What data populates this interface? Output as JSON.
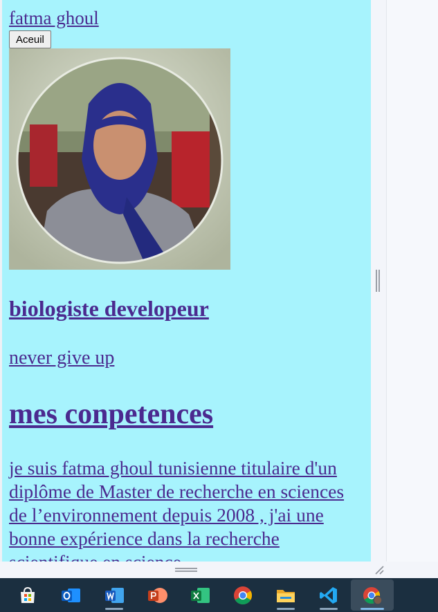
{
  "site": {
    "title": "fatma ghoul",
    "home_button": "Aceuil"
  },
  "profile": {
    "role_heading": "biologiste developeur",
    "motto": "never give up"
  },
  "skills": {
    "heading": "mes conpetences",
    "bio": "je suis fatma ghoul tunisienne titulaire d'un diplôme de Master de recherche en sciences de l’environnement depuis 2008 , j'ai une bonne expérience dans la recherche scientifique en science"
  },
  "colors": {
    "page_background": "#a7f3fd",
    "link": "#4b2a8f"
  },
  "taskbar": {
    "apps": [
      {
        "icon": "microsoft-store-icon",
        "running": false
      },
      {
        "icon": "outlook-icon",
        "running": false
      },
      {
        "icon": "word-icon",
        "running": true
      },
      {
        "icon": "powerpoint-icon",
        "running": false
      },
      {
        "icon": "excel-icon",
        "running": false
      },
      {
        "icon": "chrome-icon",
        "running": false
      },
      {
        "icon": "file-explorer-icon",
        "running": true
      },
      {
        "icon": "vscode-icon",
        "running": true
      },
      {
        "icon": "chrome-profile-icon",
        "running": true,
        "active": true
      }
    ]
  }
}
